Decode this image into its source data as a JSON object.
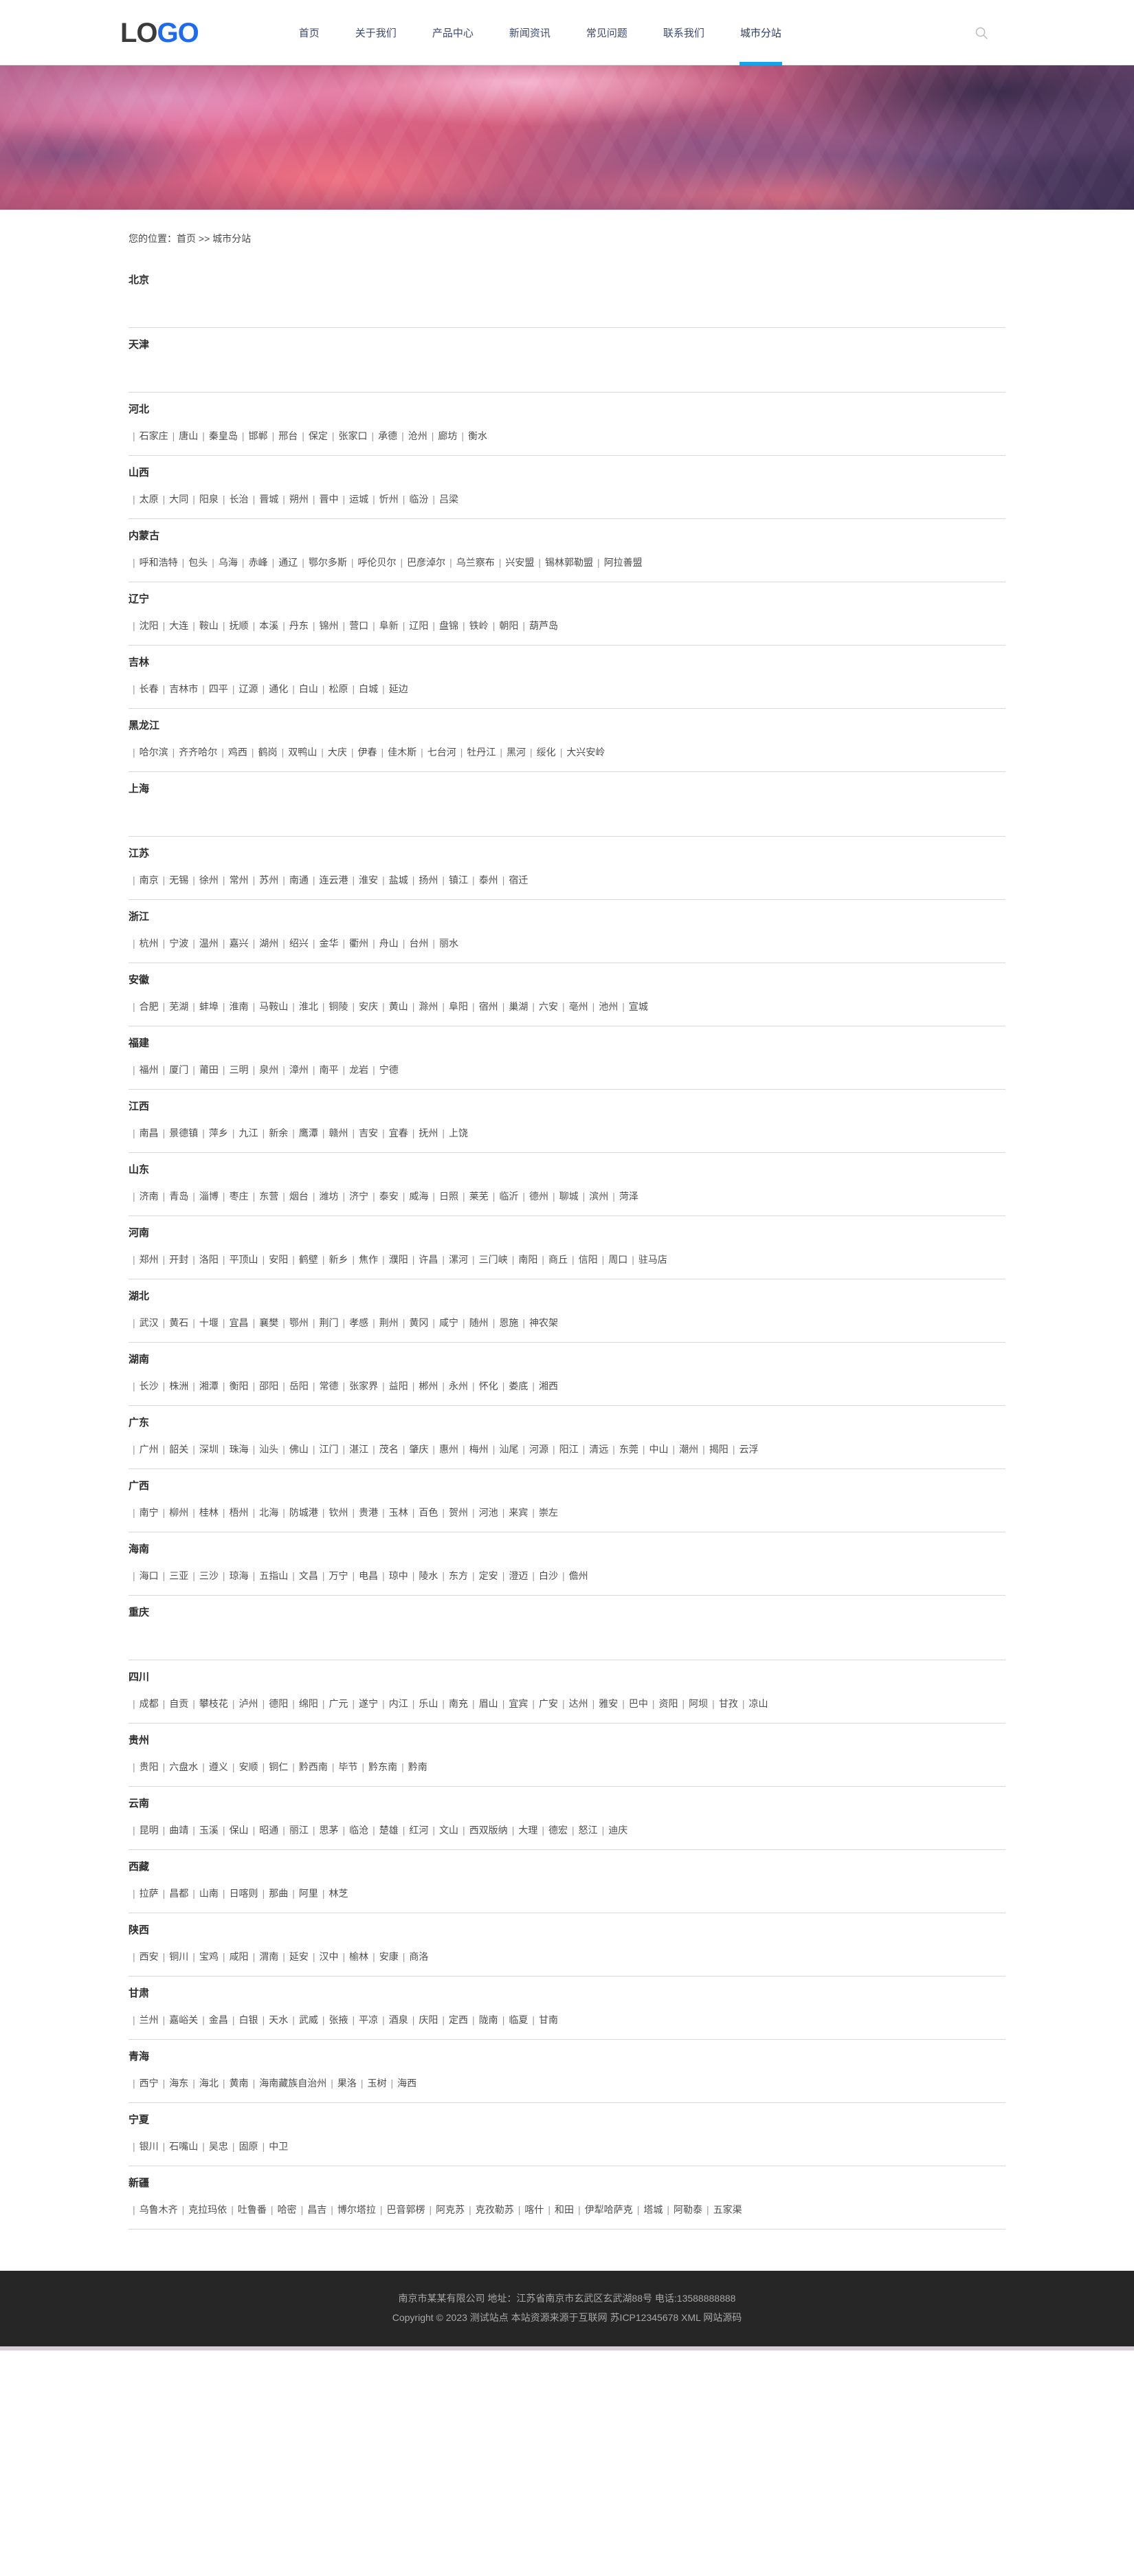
{
  "header": {
    "logo": {
      "part1": "LO",
      "part2": "GO"
    },
    "nav": [
      {
        "label": "首页",
        "active": false
      },
      {
        "label": "关于我们",
        "active": false
      },
      {
        "label": "产品中心",
        "active": false
      },
      {
        "label": "新闻资讯",
        "active": false
      },
      {
        "label": "常见问题",
        "active": false
      },
      {
        "label": "联系我们",
        "active": false
      },
      {
        "label": "城市分站",
        "active": true
      }
    ],
    "search_icon": "search-icon",
    "accent_color": "#18a3e8",
    "nav_text_color": "#3c4a73"
  },
  "banner": {
    "alt": "粉紫色晚霞云层横幅",
    "colors": [
      "#e87fae",
      "#e0688f",
      "#d6607f",
      "#7e5686",
      "#4a3a62"
    ]
  },
  "breadcrumb": {
    "text": "您的位置：首页 >> 城市分站",
    "prefix": "您的位置：",
    "home": "首页",
    "separator": ">>",
    "current": "城市分站"
  },
  "provinces": [
    {
      "name": "北京",
      "cities": []
    },
    {
      "name": "天津",
      "cities": []
    },
    {
      "name": "河北",
      "cities": [
        "石家庄",
        "唐山",
        "秦皇岛",
        "邯郸",
        "邢台",
        "保定",
        "张家口",
        "承德",
        "沧州",
        "廊坊",
        "衡水"
      ]
    },
    {
      "name": "山西",
      "cities": [
        "太原",
        "大同",
        "阳泉",
        "长治",
        "晋城",
        "朔州",
        "晋中",
        "运城",
        "忻州",
        "临汾",
        "吕梁"
      ]
    },
    {
      "name": "内蒙古",
      "cities": [
        "呼和浩特",
        "包头",
        "乌海",
        "赤峰",
        "通辽",
        "鄂尔多斯",
        "呼伦贝尔",
        "巴彦淖尔",
        "乌兰察布",
        "兴安盟",
        "锡林郭勒盟",
        "阿拉善盟"
      ]
    },
    {
      "name": "辽宁",
      "cities": [
        "沈阳",
        "大连",
        "鞍山",
        "抚顺",
        "本溪",
        "丹东",
        "锦州",
        "营口",
        "阜新",
        "辽阳",
        "盘锦",
        "铁岭",
        "朝阳",
        "葫芦岛"
      ]
    },
    {
      "name": "吉林",
      "cities": [
        "长春",
        "吉林市",
        "四平",
        "辽源",
        "通化",
        "白山",
        "松原",
        "白城",
        "延边"
      ]
    },
    {
      "name": "黑龙江",
      "cities": [
        "哈尔滨",
        "齐齐哈尔",
        "鸡西",
        "鹤岗",
        "双鸭山",
        "大庆",
        "伊春",
        "佳木斯",
        "七台河",
        "牡丹江",
        "黑河",
        "绥化",
        "大兴安岭"
      ]
    },
    {
      "name": "上海",
      "cities": []
    },
    {
      "name": "江苏",
      "cities": [
        "南京",
        "无锡",
        "徐州",
        "常州",
        "苏州",
        "南通",
        "连云港",
        "淮安",
        "盐城",
        "扬州",
        "镇江",
        "泰州",
        "宿迁"
      ]
    },
    {
      "name": "浙江",
      "cities": [
        "杭州",
        "宁波",
        "温州",
        "嘉兴",
        "湖州",
        "绍兴",
        "金华",
        "衢州",
        "舟山",
        "台州",
        "丽水"
      ]
    },
    {
      "name": "安徽",
      "cities": [
        "合肥",
        "芜湖",
        "蚌埠",
        "淮南",
        "马鞍山",
        "淮北",
        "铜陵",
        "安庆",
        "黄山",
        "滁州",
        "阜阳",
        "宿州",
        "巢湖",
        "六安",
        "亳州",
        "池州",
        "宣城"
      ]
    },
    {
      "name": "福建",
      "cities": [
        "福州",
        "厦门",
        "莆田",
        "三明",
        "泉州",
        "漳州",
        "南平",
        "龙岩",
        "宁德"
      ]
    },
    {
      "name": "江西",
      "cities": [
        "南昌",
        "景德镇",
        "萍乡",
        "九江",
        "新余",
        "鹰潭",
        "赣州",
        "吉安",
        "宜春",
        "抚州",
        "上饶"
      ]
    },
    {
      "name": "山东",
      "cities": [
        "济南",
        "青岛",
        "淄博",
        "枣庄",
        "东营",
        "烟台",
        "潍坊",
        "济宁",
        "泰安",
        "威海",
        "日照",
        "莱芜",
        "临沂",
        "德州",
        "聊城",
        "滨州",
        "菏泽"
      ]
    },
    {
      "name": "河南",
      "cities": [
        "郑州",
        "开封",
        "洛阳",
        "平顶山",
        "安阳",
        "鹤壁",
        "新乡",
        "焦作",
        "濮阳",
        "许昌",
        "漯河",
        "三门峡",
        "南阳",
        "商丘",
        "信阳",
        "周口",
        "驻马店"
      ]
    },
    {
      "name": "湖北",
      "cities": [
        "武汉",
        "黄石",
        "十堰",
        "宜昌",
        "襄樊",
        "鄂州",
        "荆门",
        "孝感",
        "荆州",
        "黄冈",
        "咸宁",
        "随州",
        "恩施",
        "神农架"
      ]
    },
    {
      "name": "湖南",
      "cities": [
        "长沙",
        "株洲",
        "湘潭",
        "衡阳",
        "邵阳",
        "岳阳",
        "常德",
        "张家界",
        "益阳",
        "郴州",
        "永州",
        "怀化",
        "娄底",
        "湘西"
      ]
    },
    {
      "name": "广东",
      "cities": [
        "广州",
        "韶关",
        "深圳",
        "珠海",
        "汕头",
        "佛山",
        "江门",
        "湛江",
        "茂名",
        "肇庆",
        "惠州",
        "梅州",
        "汕尾",
        "河源",
        "阳江",
        "清远",
        "东莞",
        "中山",
        "潮州",
        "揭阳",
        "云浮"
      ]
    },
    {
      "name": "广西",
      "cities": [
        "南宁",
        "柳州",
        "桂林",
        "梧州",
        "北海",
        "防城港",
        "钦州",
        "贵港",
        "玉林",
        "百色",
        "贺州",
        "河池",
        "来宾",
        "崇左"
      ]
    },
    {
      "name": "海南",
      "cities": [
        "海口",
        "三亚",
        "三沙",
        "琼海",
        "五指山",
        "文昌",
        "万宁",
        "电昌",
        "琼中",
        "陵水",
        "东方",
        "定安",
        "澄迈",
        "白沙",
        "儋州"
      ]
    },
    {
      "name": "重庆",
      "cities": []
    },
    {
      "name": "四川",
      "cities": [
        "成都",
        "自贡",
        "攀枝花",
        "泸州",
        "德阳",
        "绵阳",
        "广元",
        "遂宁",
        "内江",
        "乐山",
        "南充",
        "眉山",
        "宜宾",
        "广安",
        "达州",
        "雅安",
        "巴中",
        "资阳",
        "阿坝",
        "甘孜",
        "凉山"
      ]
    },
    {
      "name": "贵州",
      "cities": [
        "贵阳",
        "六盘水",
        "遵义",
        "安顺",
        "铜仁",
        "黔西南",
        "毕节",
        "黔东南",
        "黔南"
      ]
    },
    {
      "name": "云南",
      "cities": [
        "昆明",
        "曲靖",
        "玉溪",
        "保山",
        "昭通",
        "丽江",
        "思茅",
        "临沧",
        "楚雄",
        "红河",
        "文山",
        "西双版纳",
        "大理",
        "德宏",
        "怒江",
        "迪庆"
      ]
    },
    {
      "name": "西藏",
      "cities": [
        "拉萨",
        "昌都",
        "山南",
        "日喀则",
        "那曲",
        "阿里",
        "林芝"
      ]
    },
    {
      "name": "陕西",
      "cities": [
        "西安",
        "铜川",
        "宝鸡",
        "咸阳",
        "渭南",
        "延安",
        "汉中",
        "榆林",
        "安康",
        "商洛"
      ]
    },
    {
      "name": "甘肃",
      "cities": [
        "兰州",
        "嘉峪关",
        "金昌",
        "白银",
        "天水",
        "武威",
        "张掖",
        "平凉",
        "酒泉",
        "庆阳",
        "定西",
        "陇南",
        "临夏",
        "甘南"
      ]
    },
    {
      "name": "青海",
      "cities": [
        "西宁",
        "海东",
        "海北",
        "黄南",
        "海南藏族自治州",
        "果洛",
        "玉树",
        "海西"
      ]
    },
    {
      "name": "宁夏",
      "cities": [
        "银川",
        "石嘴山",
        "吴忠",
        "固原",
        "中卫"
      ]
    },
    {
      "name": "新疆",
      "cities": [
        "乌鲁木齐",
        "克拉玛依",
        "吐鲁番",
        "哈密",
        "昌吉",
        "博尔塔拉",
        "巴音郭楞",
        "阿克苏",
        "克孜勒苏",
        "喀什",
        "和田",
        "伊犁哈萨克",
        "塔城",
        "阿勒泰",
        "五家渠"
      ]
    }
  ],
  "footer": {
    "line1": "南京市某某有限公司 地址：江苏省南京市玄武区玄武湖88号 电话:13588888888",
    "line2_prefix": "Copyright © 2023 测试站点 本站资源来源于互联网",
    "icp": "苏ICP12345678",
    "xml": "XML",
    "source": "网站源码"
  }
}
